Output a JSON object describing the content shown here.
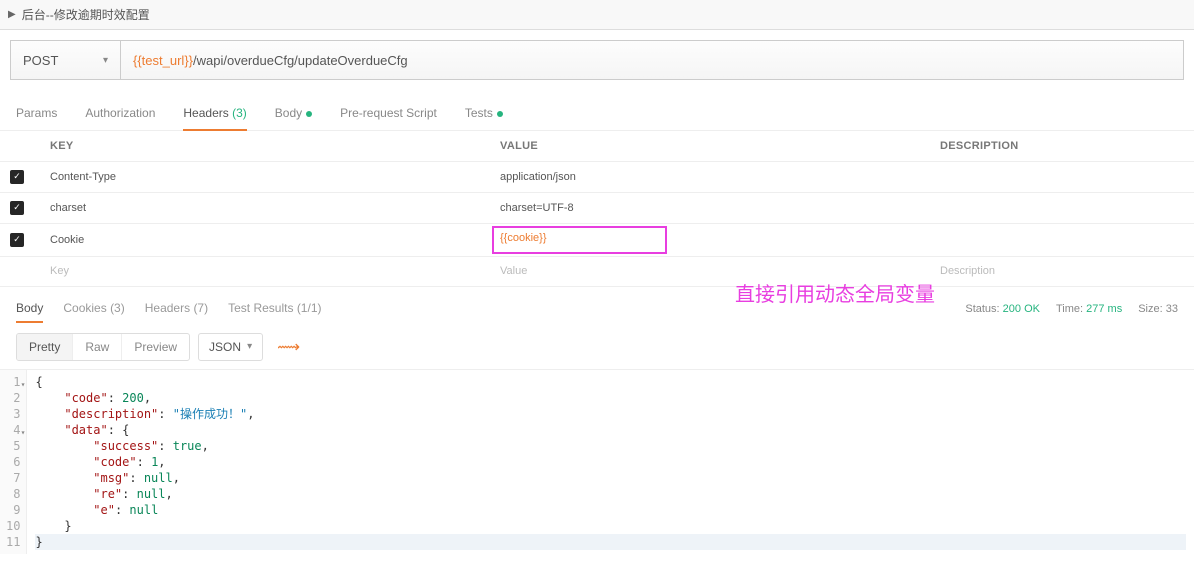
{
  "header": {
    "title": "后台--修改逾期时效配置"
  },
  "request": {
    "method": "POST",
    "url_variable": "{{test_url}}",
    "url_path": "/wapi/overdueCfg/updateOverdueCfg"
  },
  "req_tabs": {
    "params": "Params",
    "authorization": "Authorization",
    "headers": "Headers",
    "headers_count": "(3)",
    "body": "Body",
    "prerequest": "Pre-request Script",
    "tests": "Tests"
  },
  "headers_table": {
    "col_key": "KEY",
    "col_value": "VALUE",
    "col_description": "DESCRIPTION",
    "rows": [
      {
        "key": "Content-Type",
        "value": "application/json"
      },
      {
        "key": "charset",
        "value": "charset=UTF-8"
      },
      {
        "key": "Cookie",
        "value": "{{cookie}}"
      }
    ],
    "placeholder": {
      "key": "Key",
      "value": "Value",
      "description": "Description"
    }
  },
  "annotation": "直接引用动态全局变量",
  "resp_tabs": {
    "body": "Body",
    "cookies": "Cookies",
    "cookies_count": "(3)",
    "headers": "Headers",
    "headers_count": "(7)",
    "test_results": "Test Results",
    "test_results_count": "(1/1)"
  },
  "resp_meta": {
    "status_label": "Status:",
    "status_value": "200 OK",
    "time_label": "Time:",
    "time_value": "277 ms",
    "size_label": "Size:",
    "size_value": "33"
  },
  "toolbar": {
    "pretty": "Pretty",
    "raw": "Raw",
    "preview": "Preview",
    "format": "JSON"
  },
  "response_lines": [
    {
      "n": 1,
      "fold": true,
      "tokens": [
        {
          "t": "punc",
          "v": "{"
        }
      ]
    },
    {
      "n": 2,
      "tokens": [
        {
          "t": "pad",
          "v": "    "
        },
        {
          "t": "key",
          "v": "\"code\""
        },
        {
          "t": "punc",
          "v": ": "
        },
        {
          "t": "num",
          "v": "200"
        },
        {
          "t": "punc",
          "v": ","
        }
      ]
    },
    {
      "n": 3,
      "tokens": [
        {
          "t": "pad",
          "v": "    "
        },
        {
          "t": "key",
          "v": "\"description\""
        },
        {
          "t": "punc",
          "v": ": "
        },
        {
          "t": "str",
          "v": "\"操作成功！\""
        },
        {
          "t": "punc",
          "v": ","
        }
      ]
    },
    {
      "n": 4,
      "fold": true,
      "tokens": [
        {
          "t": "pad",
          "v": "    "
        },
        {
          "t": "key",
          "v": "\"data\""
        },
        {
          "t": "punc",
          "v": ": {"
        }
      ]
    },
    {
      "n": 5,
      "tokens": [
        {
          "t": "pad",
          "v": "        "
        },
        {
          "t": "key",
          "v": "\"success\""
        },
        {
          "t": "punc",
          "v": ": "
        },
        {
          "t": "kw",
          "v": "true"
        },
        {
          "t": "punc",
          "v": ","
        }
      ]
    },
    {
      "n": 6,
      "tokens": [
        {
          "t": "pad",
          "v": "        "
        },
        {
          "t": "key",
          "v": "\"code\""
        },
        {
          "t": "punc",
          "v": ": "
        },
        {
          "t": "num",
          "v": "1"
        },
        {
          "t": "punc",
          "v": ","
        }
      ]
    },
    {
      "n": 7,
      "tokens": [
        {
          "t": "pad",
          "v": "        "
        },
        {
          "t": "key",
          "v": "\"msg\""
        },
        {
          "t": "punc",
          "v": ": "
        },
        {
          "t": "kw",
          "v": "null"
        },
        {
          "t": "punc",
          "v": ","
        }
      ]
    },
    {
      "n": 8,
      "tokens": [
        {
          "t": "pad",
          "v": "        "
        },
        {
          "t": "key",
          "v": "\"re\""
        },
        {
          "t": "punc",
          "v": ": "
        },
        {
          "t": "kw",
          "v": "null"
        },
        {
          "t": "punc",
          "v": ","
        }
      ]
    },
    {
      "n": 9,
      "tokens": [
        {
          "t": "pad",
          "v": "        "
        },
        {
          "t": "key",
          "v": "\"e\""
        },
        {
          "t": "punc",
          "v": ": "
        },
        {
          "t": "kw",
          "v": "null"
        }
      ]
    },
    {
      "n": 10,
      "tokens": [
        {
          "t": "pad",
          "v": "    "
        },
        {
          "t": "punc",
          "v": "}"
        }
      ]
    },
    {
      "n": 11,
      "current": true,
      "tokens": [
        {
          "t": "punc",
          "v": "}"
        }
      ]
    }
  ]
}
